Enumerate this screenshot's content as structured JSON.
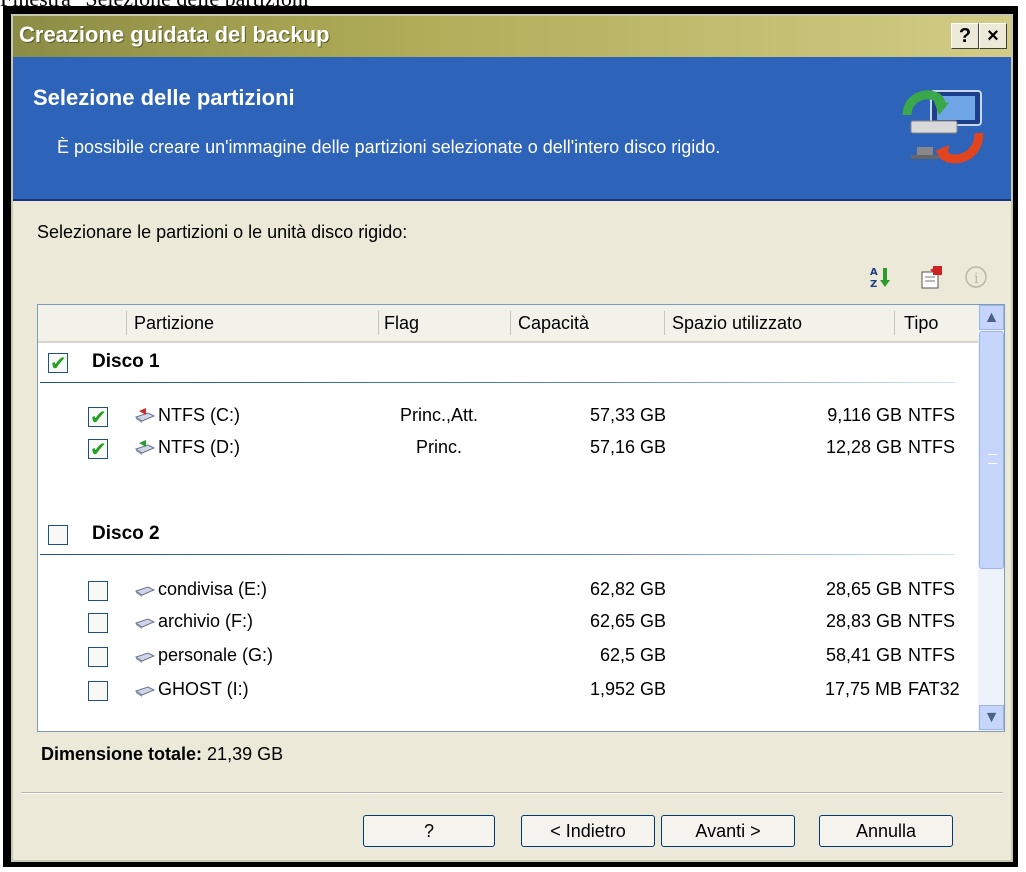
{
  "caption": "Finestra \"Selezione delle partizioni\"",
  "window": {
    "title": "Creazione guidata del backup",
    "help_btn": "?",
    "close_btn": "×"
  },
  "header": {
    "title": "Selezione delle partizioni",
    "subtitle": "È possibile creare un'immagine delle partizioni selezionate o dell'intero disco rigido."
  },
  "instruction": "Selezionare le partizioni o le unità disco rigido:",
  "toolbar": {
    "icons": [
      "sort-az-icon",
      "properties-icon",
      "info-icon"
    ]
  },
  "columns": [
    "Partizione",
    "Flag",
    "Capacità",
    "Spazio utilizzato",
    "Tipo"
  ],
  "disks": [
    {
      "label": "Disco 1",
      "checked": true,
      "partitions": [
        {
          "name": "NTFS (C:)",
          "flag": "Princ.,Att.",
          "capacity": "57,33 GB",
          "used": "9,116 GB",
          "type": "NTFS",
          "checked": true
        },
        {
          "name": "NTFS (D:)",
          "flag": "Princ.",
          "capacity": "57,16 GB",
          "used": "12,28 GB",
          "type": "NTFS",
          "checked": true
        }
      ]
    },
    {
      "label": "Disco 2",
      "checked": false,
      "partitions": [
        {
          "name": "condivisa (E:)",
          "flag": "",
          "capacity": "62,82 GB",
          "used": "28,65 GB",
          "type": "NTFS",
          "checked": false
        },
        {
          "name": "archivio (F:)",
          "flag": "",
          "capacity": "62,65 GB",
          "used": "28,83 GB",
          "type": "NTFS",
          "checked": false
        },
        {
          "name": "personale (G:)",
          "flag": "",
          "capacity": "62,5 GB",
          "used": "58,41 GB",
          "type": "NTFS",
          "checked": false
        },
        {
          "name": "GHOST (I:)",
          "flag": "",
          "capacity": "1,952 GB",
          "used": "17,75 MB",
          "type": "FAT32",
          "checked": false
        }
      ]
    }
  ],
  "total": {
    "label": "Dimensione totale:",
    "value": "21,39 GB"
  },
  "buttons": {
    "help": "?",
    "back": "< Indietro",
    "next": "Avanti >",
    "cancel": "Annulla"
  },
  "colors": {
    "header_bg": "#2d63b8",
    "check_green": "#21a121",
    "dialog_bg": "#ece9d8"
  }
}
